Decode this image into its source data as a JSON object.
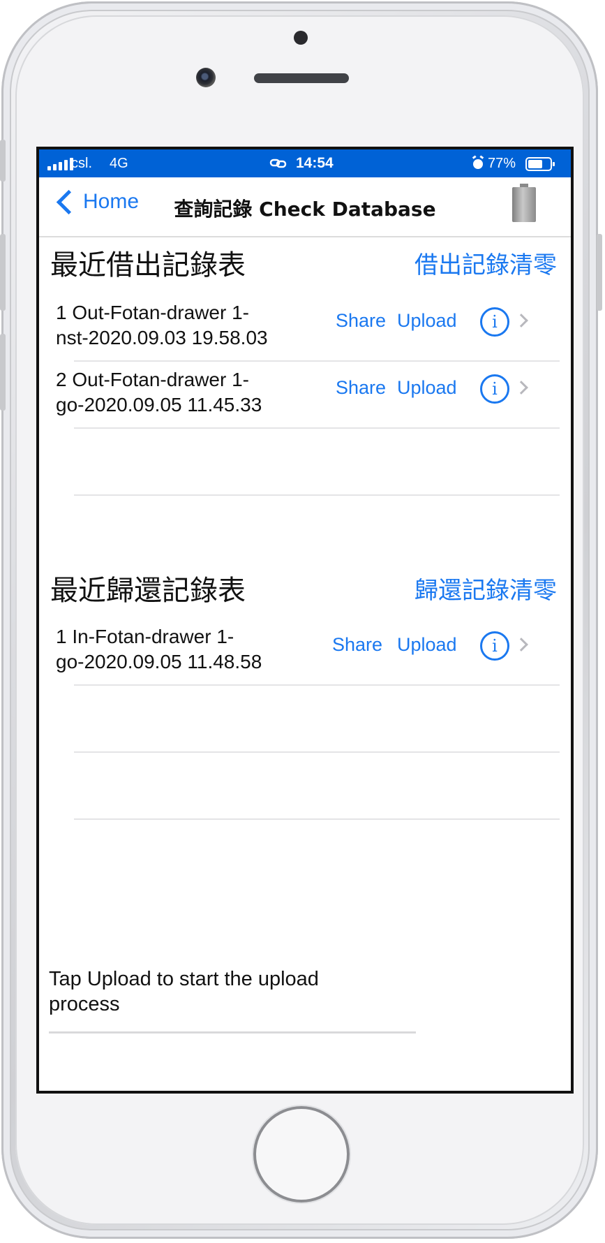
{
  "status_bar": {
    "carrier": "csl.",
    "network": "4G",
    "time": "14:54",
    "battery_percent": "77%",
    "battery_level": 0.77,
    "icons": [
      "signal-bars-icon",
      "link-icon",
      "alarm-icon",
      "battery-icon"
    ]
  },
  "nav": {
    "back_label": "Home",
    "title": "查詢記錄 Check Database",
    "icons": [
      "chevron-left-icon",
      "battery-icon"
    ]
  },
  "checkout": {
    "title": "最近借出記錄表",
    "clear_label": "借出記錄清零",
    "rows": [
      {
        "line1": "1 Out-Fotan-drawer 1-",
        "line2": "nst-2020.09.03 19.58.03",
        "share": "Share",
        "upload": "Upload",
        "info": "i"
      },
      {
        "line1": "2 Out-Fotan-drawer 1-",
        "line2": "go-2020.09.05 11.45.33",
        "share": "Share",
        "upload": "Upload",
        "info": "i"
      }
    ]
  },
  "return": {
    "title": "最近歸還記錄表",
    "clear_label": "歸還記錄清零",
    "rows": [
      {
        "line1": "1 In-Fotan-drawer 1-",
        "line2": "go-2020.09.05 11.48.58",
        "share": "Share",
        "upload": "Upload",
        "info": "i"
      }
    ]
  },
  "footer": {
    "hint": "Tap Upload to start the upload process"
  },
  "colors": {
    "status_bar": "#0062d6",
    "accent": "#1a78f0",
    "text": "#111111",
    "separator": "#e4e4e6"
  }
}
